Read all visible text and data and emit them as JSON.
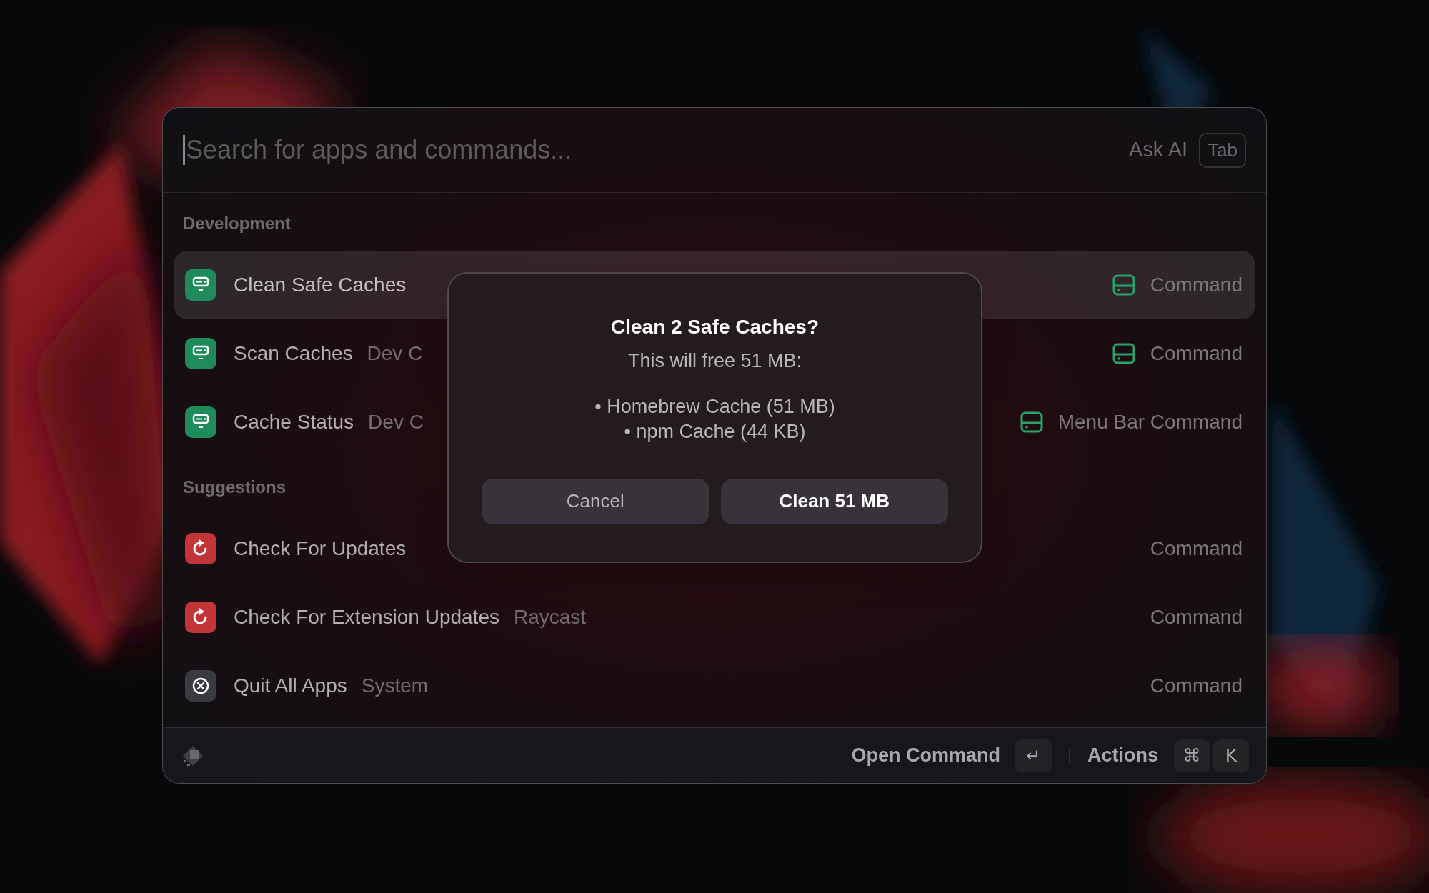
{
  "search": {
    "placeholder": "Search for apps and commands...",
    "ask_ai": "Ask AI",
    "ask_ai_key": "Tab"
  },
  "sections": [
    {
      "title": "Development",
      "items": [
        {
          "title": "Clean Safe Caches",
          "kind": "cache",
          "selected": true,
          "drive_badge": true,
          "accessory": "Command"
        },
        {
          "title": "Scan Caches",
          "subtitle": "Dev C",
          "kind": "cache",
          "selected": false,
          "drive_badge": true,
          "accessory": "Command"
        },
        {
          "title": "Cache Status",
          "subtitle": "Dev C",
          "kind": "cache",
          "selected": false,
          "drive_badge": true,
          "accessory": "Menu Bar Command"
        }
      ]
    },
    {
      "title": "Suggestions",
      "items": [
        {
          "title": "Check For Updates",
          "kind": "refresh",
          "selected": false,
          "drive_badge": false,
          "accessory": "Command"
        },
        {
          "title": "Check For Extension Updates",
          "subtitle": "Raycast",
          "kind": "refresh",
          "selected": false,
          "drive_badge": false,
          "accessory": "Command"
        },
        {
          "title": "Quit All Apps",
          "subtitle": "System",
          "kind": "quit",
          "selected": false,
          "drive_badge": false,
          "accessory": "Command"
        }
      ]
    }
  ],
  "dialog": {
    "title": "Clean 2 Safe Caches?",
    "message": "This will free 51 MB:",
    "bullets": [
      "• Homebrew Cache (51 MB)",
      "• npm Cache (44 KB)"
    ],
    "buttons": [
      {
        "label": "Cancel",
        "kind": "cancel"
      },
      {
        "label": "Clean 51 MB",
        "kind": "primary"
      }
    ]
  },
  "footer": {
    "primary_action": "Open Command",
    "primary_key": "↵",
    "secondary_action": "Actions",
    "secondary_keys": [
      "⌘",
      "K"
    ]
  }
}
